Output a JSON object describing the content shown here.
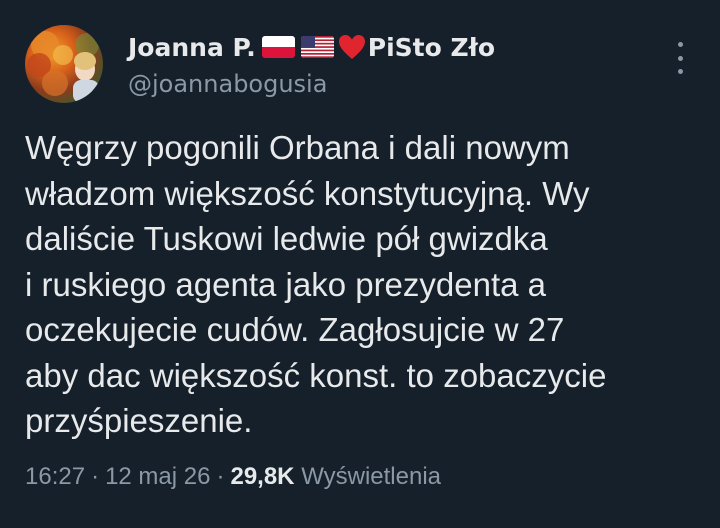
{
  "author": {
    "display_name": "Joanna P.",
    "name_suffix": "PiSto Zło",
    "handle": "@joannabogusia",
    "emojis": [
      "flag-poland-icon",
      "flag-usa-icon",
      "red-heart-icon"
    ]
  },
  "tweet": {
    "lines": [
      "Węgrzy pogonili Orbana i dali nowym",
      "władzom większość konstytucyjną. Wy",
      "daliście Tuskowi ledwie pół gwizdka",
      "i ruskiego agenta jako prezydenta a",
      "oczekujecie cudów. Zagłosujcie w 27",
      "aby dac większość konst. to zobaczycie",
      "przyśpieszenie."
    ]
  },
  "meta": {
    "time": "16:27",
    "date": "12 maj 26",
    "views_count": "29,8K",
    "views_label": "Wyświetlenia",
    "separator": "·"
  },
  "colors": {
    "background": "#15202b",
    "primary_text": "#e7e9ea",
    "secondary_text": "#8b98a5"
  }
}
